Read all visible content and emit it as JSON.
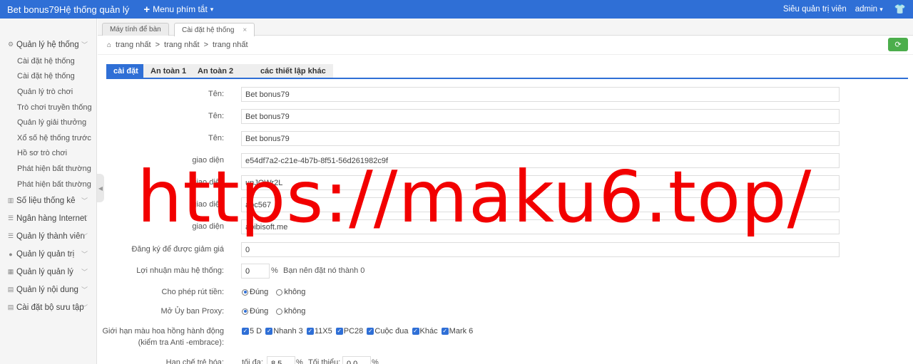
{
  "topbar": {
    "brand": "Bet bonus79Hệ thống quản lý",
    "quick_menu": "Menu phím tắt",
    "role": "Siêu quản trị viên",
    "user": "admin"
  },
  "sidebar": {
    "groups": [
      {
        "label": "Quản lý hệ thống",
        "icon": "gear-icon",
        "expanded": true,
        "items": [
          "Cài đặt hệ thống",
          "Cài đặt hệ thống",
          "Quản lý trò chơi",
          "Trò chơi truyền thống",
          "Quản lý giải thưởng",
          "Xổ số hệ thống trước",
          "Hồ sơ trò chơi",
          "Phát hiện bất thường",
          "Phát hiện bất thường"
        ]
      },
      {
        "label": "Số liệu thống kê",
        "icon": "chart-icon"
      },
      {
        "label": "Ngân hàng Internet",
        "icon": "list-icon"
      },
      {
        "label": "Quản lý thành viên",
        "icon": "list-icon"
      },
      {
        "label": "Quản lý quản trị",
        "icon": "user-icon"
      },
      {
        "label": "Quản lý quản lý",
        "icon": "grid-icon"
      },
      {
        "label": "Quản lý nội dung",
        "icon": "doc-icon"
      },
      {
        "label": "Cài đặt bộ sưu tập",
        "icon": "doc-icon"
      }
    ]
  },
  "page_tabs": [
    {
      "label": "Máy tính để bàn",
      "active": false
    },
    {
      "label": "Cài đặt hệ thống",
      "active": true
    }
  ],
  "breadcrumb": [
    "trang nhất",
    "trang nhất",
    "trang nhất"
  ],
  "settings_tabs": [
    "cài đặt",
    "An toàn 1",
    "An toàn 2",
    "các thiết lập khác"
  ],
  "form": {
    "fields": [
      {
        "label": "Tên:",
        "value": "Bet bonus79"
      },
      {
        "label": "Tên:",
        "value": "Bet bonus79"
      },
      {
        "label": "Tên:",
        "value": "Bet bonus79"
      },
      {
        "label": "giao diện",
        "value": "e54df7a2-c21e-4b7b-8f51-56d261982c9f"
      },
      {
        "label": "giao diện",
        "value": "unJQWr2L"
      },
      {
        "label": "giao diện",
        "value": "abc567"
      },
      {
        "label": "giao diện",
        "value": "apibisoft.me"
      },
      {
        "label": "Đăng ký để được giảm giá",
        "value": "0"
      }
    ],
    "profit": {
      "label": "Lợi nhuận màu hệ thống:",
      "value": "0",
      "unit": "%",
      "hint": "Bạn nên đặt nó thành 0"
    },
    "withdraw": {
      "label": "Cho phép rút tiền:",
      "yes": "Đúng",
      "no": "không"
    },
    "proxy": {
      "label": "Mở Ủy ban Proxy:",
      "yes": "Đúng",
      "no": "không"
    },
    "limit": {
      "label1": "Giới hạn màu hoa hồng hành động",
      "label2": "(kiểm tra Anti -embrace):",
      "options": [
        "5 D",
        "Nhanh 3",
        "11X5",
        "PC28",
        "Cuộc đua",
        "Khác",
        "Mark 6"
      ]
    },
    "rejuv": {
      "label": "Hạn chế trẻ hóa:",
      "max_label": "tối đa:",
      "max_value": "8.5",
      "min_label": "Tối thiểu:",
      "min_value": "0.0",
      "unit": "%"
    }
  },
  "watermark": "https://maku6.top/",
  "colors": {
    "accent": "#2f6fd6",
    "watermark": "#f20000",
    "refresh": "#4cae4c"
  }
}
